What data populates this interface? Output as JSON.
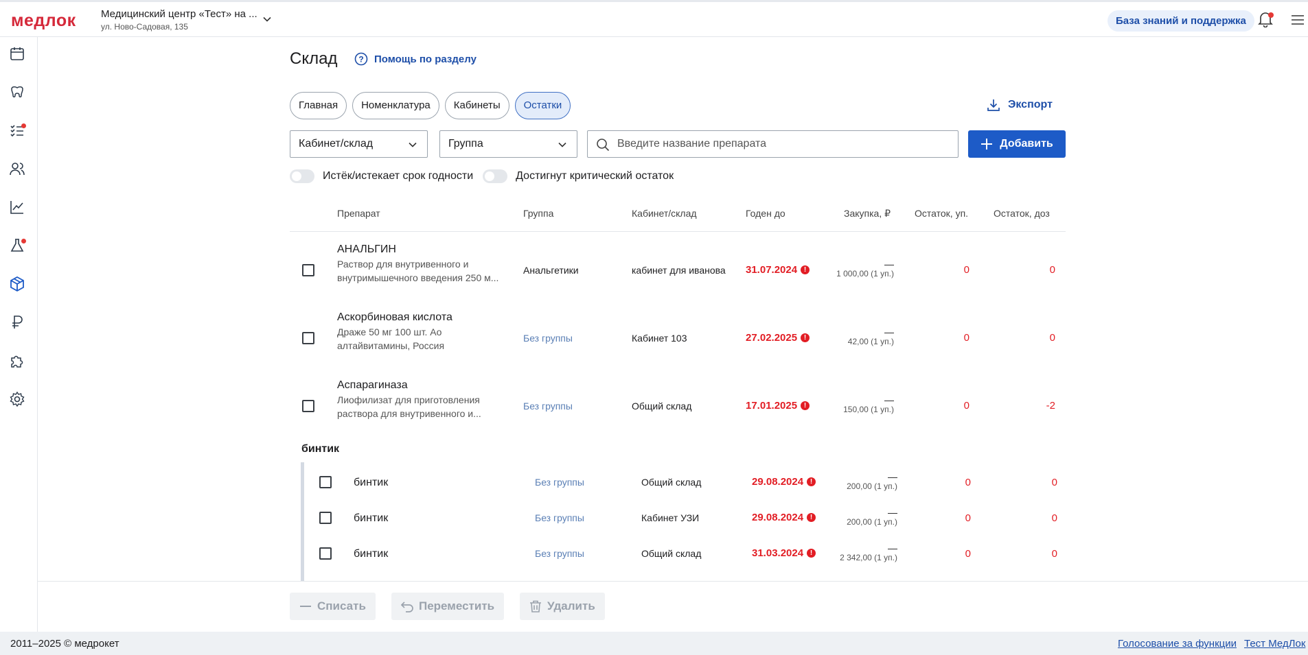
{
  "header": {
    "logo": "медлок",
    "clinic_name": "Медицинский центр «Тест» на ...",
    "clinic_address": "ул. Ново-Садовая, 135",
    "kb_label": "База знаний и поддержка"
  },
  "sidebar": {
    "items": [
      "calendar-icon",
      "tooth-icon",
      "tasks-icon",
      "users-icon",
      "chart-icon",
      "flask-icon",
      "box-icon",
      "ruble-icon",
      "puzzle-icon",
      "gear-icon"
    ]
  },
  "page": {
    "title": "Склад",
    "help_label": "Помощь по разделу",
    "tabs": [
      "Главная",
      "Номенклатура",
      "Кабинеты",
      "Остатки"
    ],
    "active_tab": "Остатки",
    "export_label": "Экспорт"
  },
  "filters": {
    "room_select": "Кабинет/склад",
    "group_select": "Группа",
    "search_placeholder": "Введите название препарата",
    "add_label": "Добавить",
    "toggle_expired": "Истёк/истекает срок годности",
    "toggle_critical": "Достигнут критический остаток"
  },
  "table": {
    "headers": [
      "Препарат",
      "Группа",
      "Кабинет/склад",
      "Годен до",
      "Закупка, ₽",
      "Остаток, уп.",
      "Остаток, доз"
    ],
    "rows": [
      {
        "name": "АНАЛЬГИН",
        "desc1": "Раствор для внутривенного и",
        "desc2": "внутримышечного введения 250 м...",
        "group": "Анальгетики",
        "room": "кабинет для иванова",
        "date": "31.07.2024",
        "dash": "—",
        "price": "1 000,00 (1 уп.)",
        "packs": "0",
        "doses": "0"
      },
      {
        "name": "Аскорбиновая кислота",
        "desc1": "Драже 50 мг 100 шт. Ао",
        "desc2": "алтайвитамины, Россия",
        "group": "Без группы",
        "room": "Кабинет 103",
        "date": "27.02.2025",
        "dash": "—",
        "price": "42,00 (1 уп.)",
        "packs": "0",
        "doses": "0"
      },
      {
        "name": "Аспарагиназа",
        "desc1": "Лиофилизат для приготовления",
        "desc2": "раствора для внутривенного и...",
        "group": "Без группы",
        "room": "Общий склад",
        "date": "17.01.2025",
        "dash": "—",
        "price": "150,00 (1 уп.)",
        "packs": "0",
        "doses": "-2"
      }
    ],
    "group_name": "бинтик",
    "group_rows": [
      {
        "name": "бинтик",
        "group": "Без группы",
        "room": "Общий склад",
        "date": "29.08.2024",
        "dash": "—",
        "price": "200,00 (1 уп.)",
        "packs": "0",
        "doses": "0"
      },
      {
        "name": "бинтик",
        "group": "Без группы",
        "room": "Кабинет УЗИ",
        "date": "29.08.2024",
        "dash": "—",
        "price": "200,00 (1 уп.)",
        "packs": "0",
        "doses": "0"
      },
      {
        "name": "бинтик",
        "group": "Без группы",
        "room": "Общий склад",
        "date": "31.03.2024",
        "dash": "—",
        "price": "2 342,00 (1 уп.)",
        "packs": "0",
        "doses": "0"
      }
    ]
  },
  "actions": {
    "writeoff": "Списать",
    "move": "Переместить",
    "delete": "Удалить"
  },
  "footer": {
    "copyright": "2011–2025 © медрокет",
    "link_vote": "Голосование за функции",
    "link_test": "Тест МедЛок"
  },
  "colors": {
    "accent": "#1d5bc7",
    "danger": "#e21d24",
    "brand": "#d5293a"
  }
}
